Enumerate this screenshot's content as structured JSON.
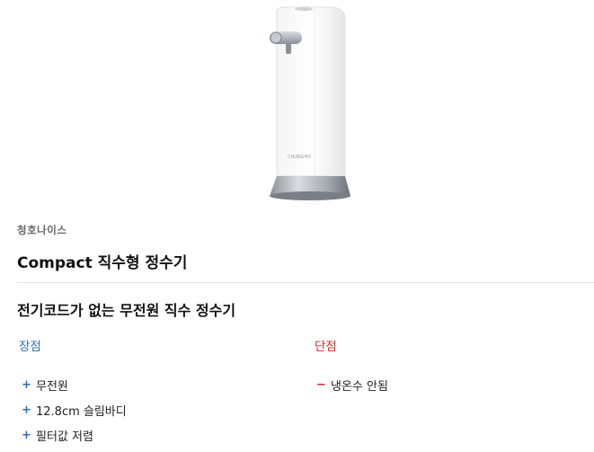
{
  "product": {
    "image_label": "CHUNGHO",
    "brand": "청호나이스",
    "name": "Compact 직수형 정수기"
  },
  "description": {
    "headline": "전기코드가 없는 무전원 직수 정수기"
  },
  "pros": {
    "heading": "장점",
    "marker": "+",
    "items": [
      "무전원",
      "12.8cm 슬림바디",
      "필터값 저렴"
    ]
  },
  "cons": {
    "heading": "단점",
    "marker": "−",
    "items": [
      "냉온수 안됨"
    ]
  },
  "colors": {
    "pros_accent": "#2f6db5",
    "cons_accent": "#d9262c"
  }
}
